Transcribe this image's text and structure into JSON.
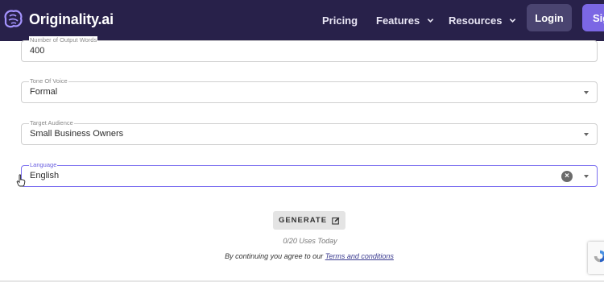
{
  "nav": {
    "brand": "Originality.ai",
    "links": [
      {
        "label": "Pricing",
        "has_dropdown": false
      },
      {
        "label": "Features",
        "has_dropdown": true
      },
      {
        "label": "Resources",
        "has_dropdown": true
      }
    ],
    "login_label": "Login",
    "signup_label": "Sig",
    "colors": {
      "background": "#28214a",
      "signup": "#7b67e4",
      "login": "#4a4470"
    }
  },
  "form": {
    "word_count": {
      "label": "Number of Output Words",
      "value": "400"
    },
    "tone": {
      "label": "Tone Of Voice",
      "value": "Formal"
    },
    "audience": {
      "label": "Target Audience",
      "value": "Small Business Owners"
    },
    "language": {
      "label": "Language",
      "value": "English"
    },
    "accent_color": "#7b6ff0"
  },
  "actions": {
    "generate_label": "GENERATE",
    "uses_text": "0/20 Uses Today",
    "consent_prefix": "By continuing you agree to our ",
    "terms_link": "Terms and conditions"
  },
  "icons": {
    "logo": "brain-logo-icon",
    "dropdown": "chevron-down-icon",
    "clear": "clear-x-icon",
    "generate": "edit-icon",
    "cursor": "hand-pointer-icon"
  }
}
